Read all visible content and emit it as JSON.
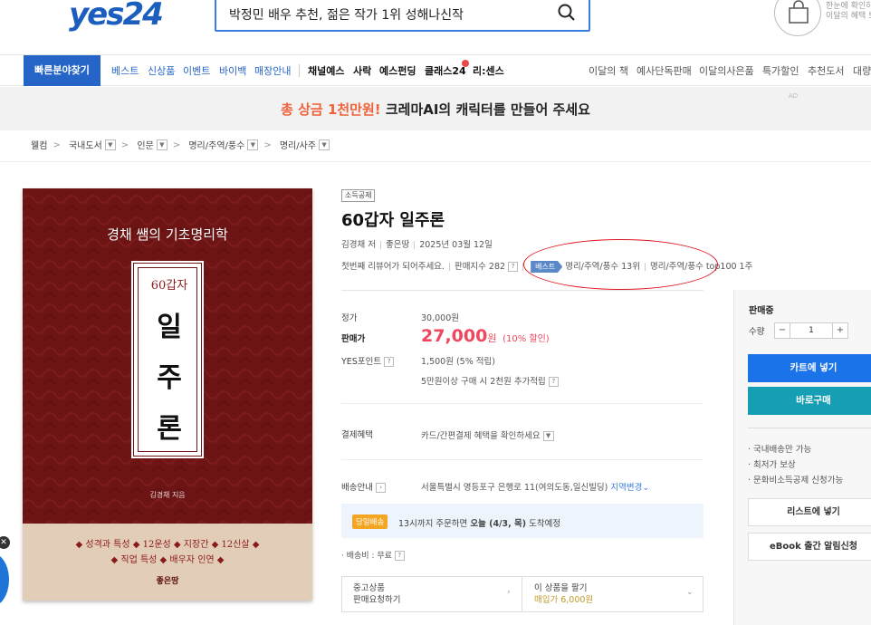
{
  "header": {
    "logo": "yes24",
    "search_value": "박정민 배우 추천, 젊은 작가 1위 성해나신작",
    "cart_promo": "한눈에 확인하 이달의 혜택 보"
  },
  "nav": {
    "quick_find": "빠른분야찾기",
    "items_blue": [
      "베스트",
      "신상품",
      "이벤트",
      "바이백",
      "매장안내"
    ],
    "items_dark": [
      "채널예스",
      "사락",
      "예스펀딩",
      "클래스24",
      "리:센스"
    ],
    "items_right": [
      "이달의 책",
      "예사단독판매",
      "이달의사은품",
      "특가할인",
      "추천도서",
      "대량"
    ]
  },
  "banner": {
    "highlight": "총 상금 1천만원!",
    "text": " 크레마AI의 캐릭터를 만들어 주세요",
    "ad": "AD"
  },
  "breadcrumb": [
    "웰컴",
    "국내도서",
    "인문",
    "명리/주역/풍수",
    "명리/사주"
  ],
  "cover": {
    "subtitle": "경채 쌤의 기초명리학",
    "label_small": "60갑자",
    "big_chars": [
      "일",
      "주",
      "론"
    ],
    "author": "김경채 지음",
    "keywords_line1": "◆ 성격과 특성 ◆ 12운성 ◆ 지장간 ◆ 12신살 ◆",
    "keywords_line2": "◆ 직업 특성 ◆ 배우자 인연 ◆",
    "publisher": "좋은땅"
  },
  "product": {
    "tax_badge": "소득공제",
    "title": "60갑자 일주론",
    "author": "김경채 저",
    "publisher": "좋은땅",
    "date": "2025년 03월 12일",
    "review": "첫번째 리뷰어가 되어주세요.",
    "sales_index": "판매지수 282",
    "best_badge": "베스트",
    "rank1": "명리/주역/풍수 13위",
    "rank2": "명리/주역/풍수 top100 1주"
  },
  "pricing": {
    "list_label": "정가",
    "list_price": "30,000원",
    "sale_label": "판매가",
    "sale_price": "27,000",
    "sale_unit": "원",
    "sale_pct": "(10% 할인)",
    "points_label": "YES포인트",
    "points_value": "1,500원 (5% 적립)",
    "points_extra": "5만원이상 구매 시 2천원 추가적립",
    "pay_label": "결제혜택",
    "pay_value": "카드/간편결제 혜택을 확인하세요",
    "ship_label": "배송안내",
    "ship_value": "서울특별시 영등포구 은행로 11(여의도동,일신빌딩)",
    "region_change": "지역변경",
    "today_badge": "당일배송",
    "delivery_pre": "13시까지 주문하면 ",
    "delivery_bold": "오늘 (4/3, 목)",
    "delivery_post": " 도착예정",
    "ship_fee": "· 배송비 : 무료",
    "used_line1": "중고상품",
    "used_line2": "판매요청하기",
    "sell_line1": "이 상품을 팔기",
    "sell_line2": "매입가 6,000원"
  },
  "buy": {
    "status": "판매중",
    "qty_label": "수량",
    "qty": "1",
    "cart": "카트에 넣기",
    "buynow": "바로구매",
    "benefits": [
      "· 국내배송만 가능",
      "· 최저가 보상",
      "· 문화비소득공제 신청가능"
    ],
    "list": "리스트에 넣기",
    "ebook": "eBook 출간 알림신청"
  },
  "colors": {
    "brand": "#2565c8",
    "sale": "#f0465e",
    "cover": "#6d1414"
  }
}
